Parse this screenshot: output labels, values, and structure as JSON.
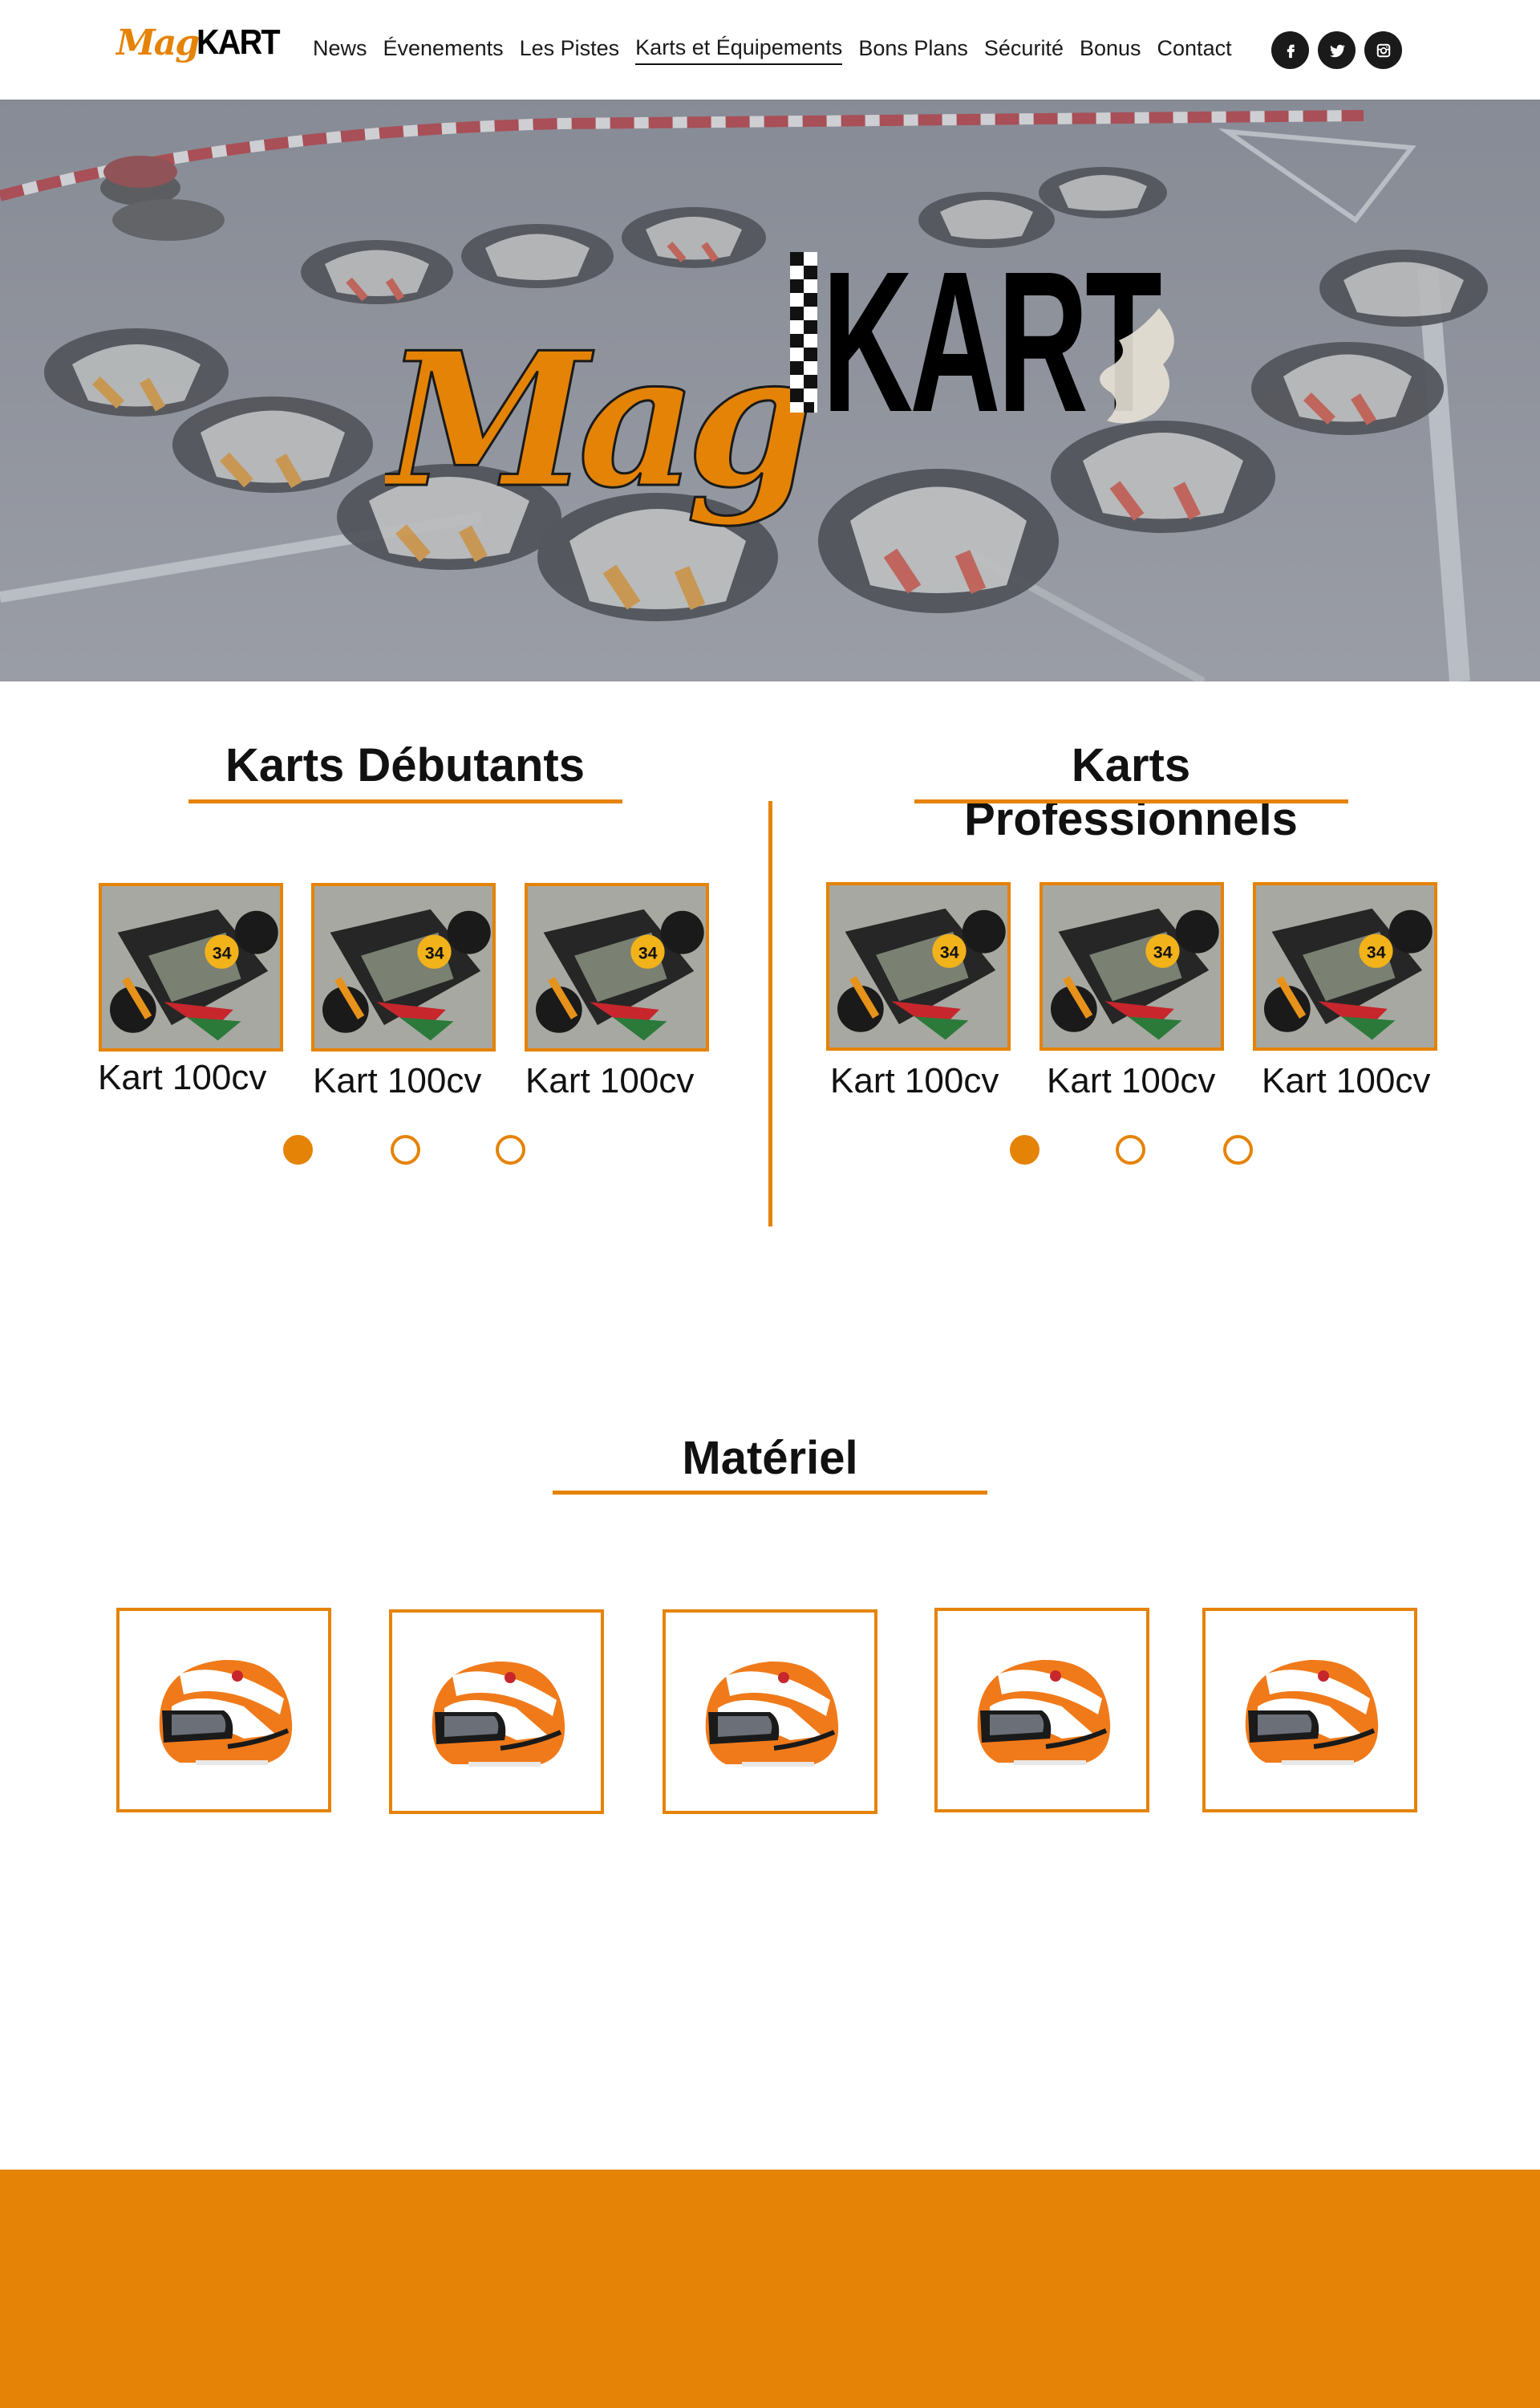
{
  "brand": {
    "name_script": "Mag",
    "name_block": "KART"
  },
  "nav": {
    "items": [
      {
        "label": "News"
      },
      {
        "label": "Évenements"
      },
      {
        "label": "Les Pistes"
      },
      {
        "label": "Karts et Équipements",
        "active": true
      },
      {
        "label": "Bons Plans"
      },
      {
        "label": "Sécurité"
      },
      {
        "label": "Bonus"
      },
      {
        "label": "Contact"
      }
    ]
  },
  "social": [
    {
      "icon": "facebook-icon"
    },
    {
      "icon": "twitter-icon"
    },
    {
      "icon": "instagram-icon"
    }
  ],
  "karts_debutants": {
    "title": "Karts Débutants",
    "items": [
      {
        "label": "Kart 100cv"
      },
      {
        "label": "Kart 100cv"
      },
      {
        "label": "Kart 100cv"
      }
    ],
    "active_slide": 1,
    "slide_count": 3
  },
  "karts_professionnels": {
    "title": "Karts Professionnels",
    "items": [
      {
        "label": "Kart 100cv"
      },
      {
        "label": "Kart 100cv"
      },
      {
        "label": "Kart 100cv"
      }
    ],
    "active_slide": 1,
    "slide_count": 3
  },
  "materiel": {
    "title": "Matériel",
    "items": [
      {
        "icon": "helmet-icon"
      },
      {
        "icon": "helmet-icon"
      },
      {
        "icon": "helmet-icon"
      },
      {
        "icon": "helmet-icon"
      },
      {
        "icon": "helmet-icon"
      }
    ]
  },
  "colors": {
    "accent": "#e58306",
    "text": "#111111",
    "footer": "#e58306"
  }
}
